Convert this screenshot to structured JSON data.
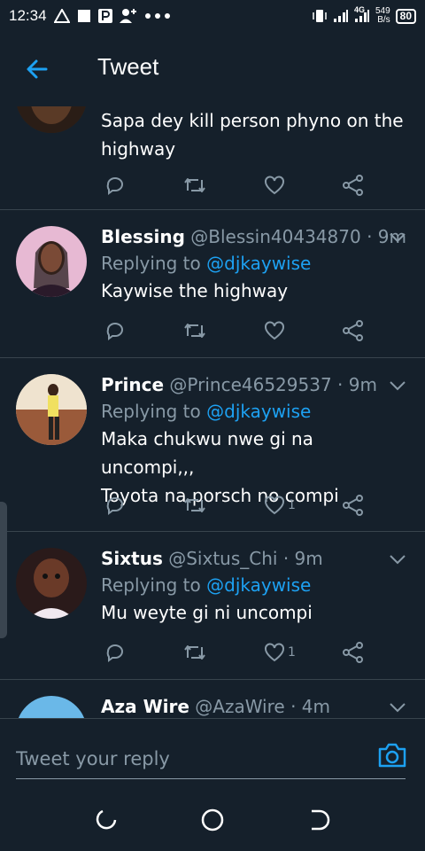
{
  "status_bar": {
    "time": "12:34",
    "network": "4G",
    "speed_value": "549",
    "speed_unit": "B/s",
    "battery": "80"
  },
  "header": {
    "title": "Tweet",
    "back_icon": "arrow-left-icon"
  },
  "tweets": [
    {
      "text_lines": [
        "Sapa dey kill person phyno on the",
        "highway"
      ],
      "like_count": ""
    },
    {
      "name": "Blessing",
      "handle": "@Blessin40434870",
      "time": "· 9m",
      "replying_prefix": "Replying to",
      "mention": "@djkaywise",
      "text_lines": [
        "Kaywise the highway"
      ],
      "like_count": ""
    },
    {
      "name": "Prince",
      "handle": "@Prince46529537",
      "time": "· 9m",
      "replying_prefix": "Replying to",
      "mention": "@djkaywise",
      "text_lines": [
        "Maka chukwu nwe gi na uncompi,,,",
        "Toyota na porsch no compi"
      ],
      "like_count": "1"
    },
    {
      "name": "Sixtus",
      "handle": "@Sixtus_Chi",
      "time": "· 9m",
      "replying_prefix": "Replying to",
      "mention": "@djkaywise",
      "text_lines": [
        "Mu weyte gi ni uncompi"
      ],
      "like_count": "1"
    },
    {
      "name": "Aza Wire",
      "handle": "@AzaWire",
      "time": "· 4m"
    }
  ],
  "reply": {
    "placeholder": "Tweet your reply"
  },
  "colors": {
    "background": "#15202b",
    "accent": "#1da1f2",
    "secondary_text": "#8899a6",
    "divider": "#38444d"
  }
}
